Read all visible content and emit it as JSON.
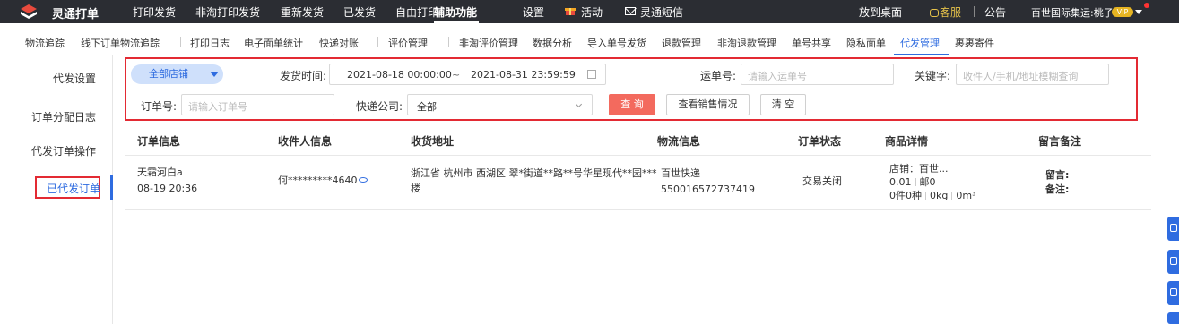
{
  "app": {
    "brand": "灵通打单"
  },
  "topnav": {
    "items": [
      "打印发货",
      "非淘打印发货",
      "重新发货",
      "已发货",
      "自由打印",
      "辅助功能",
      "设置",
      "活动",
      "灵通短信"
    ],
    "right": {
      "desktop": "放到桌面",
      "kefu": "客服",
      "notice": "公告",
      "user": "百世国际集运:桃子",
      "vip": "VIP"
    }
  },
  "subnav": {
    "items": [
      "物流追踪",
      "线下订单物流追踪",
      "打印日志",
      "电子面单统计",
      "快递对账",
      "评价管理",
      "非淘评价管理",
      "数据分析",
      "导入单号发货",
      "退款管理",
      "非淘退款管理",
      "单号共享",
      "隐私面单",
      "代发管理",
      "裹裹寄件"
    ],
    "active_index": 13
  },
  "side": {
    "items": [
      "代发设置",
      "订单分配日志",
      "代发订单操作",
      "已代发订单"
    ],
    "active_index": 3
  },
  "filter": {
    "store": "全部店铺",
    "time_label": "发货时间:",
    "time_start": "2021-08-18 00:00:00",
    "time_sep": "~",
    "time_end": "2021-08-31 23:59:59",
    "waybill_label": "运单号:",
    "waybill_placeholder": "请输入运单号",
    "keyword_label": "关键字:",
    "keyword_placeholder": "收件人/手机/地址模糊查询",
    "order_label": "订单号:",
    "order_placeholder": "请输入订单号",
    "express_label": "快递公司:",
    "express_value": "全部",
    "query_button": "查 询",
    "sales_button": "查看销售情况",
    "clear_button": "清 空"
  },
  "table": {
    "headers": [
      "订单信息",
      "收件人信息",
      "收货地址",
      "物流信息",
      "订单状态",
      "商品详情",
      "留言备注"
    ],
    "rows": [
      {
        "buyer": "天霜河白a",
        "time": "08-19 20:36",
        "receiver": "何*********4640",
        "address_line1": "浙江省 杭州市 西湖区 翠*街道**路**号华星现代**园***",
        "address_line2": "楼",
        "express": "百世快递",
        "waybill": "550016572737419",
        "status": "交易关闭",
        "shop": "店铺：百世...",
        "price": "0.01",
        "shipping": "邮0",
        "count": "0件0种",
        "weight": "0kg",
        "volume": "0m³",
        "message_label": "留言:",
        "remark_label": "备注:"
      }
    ]
  }
}
